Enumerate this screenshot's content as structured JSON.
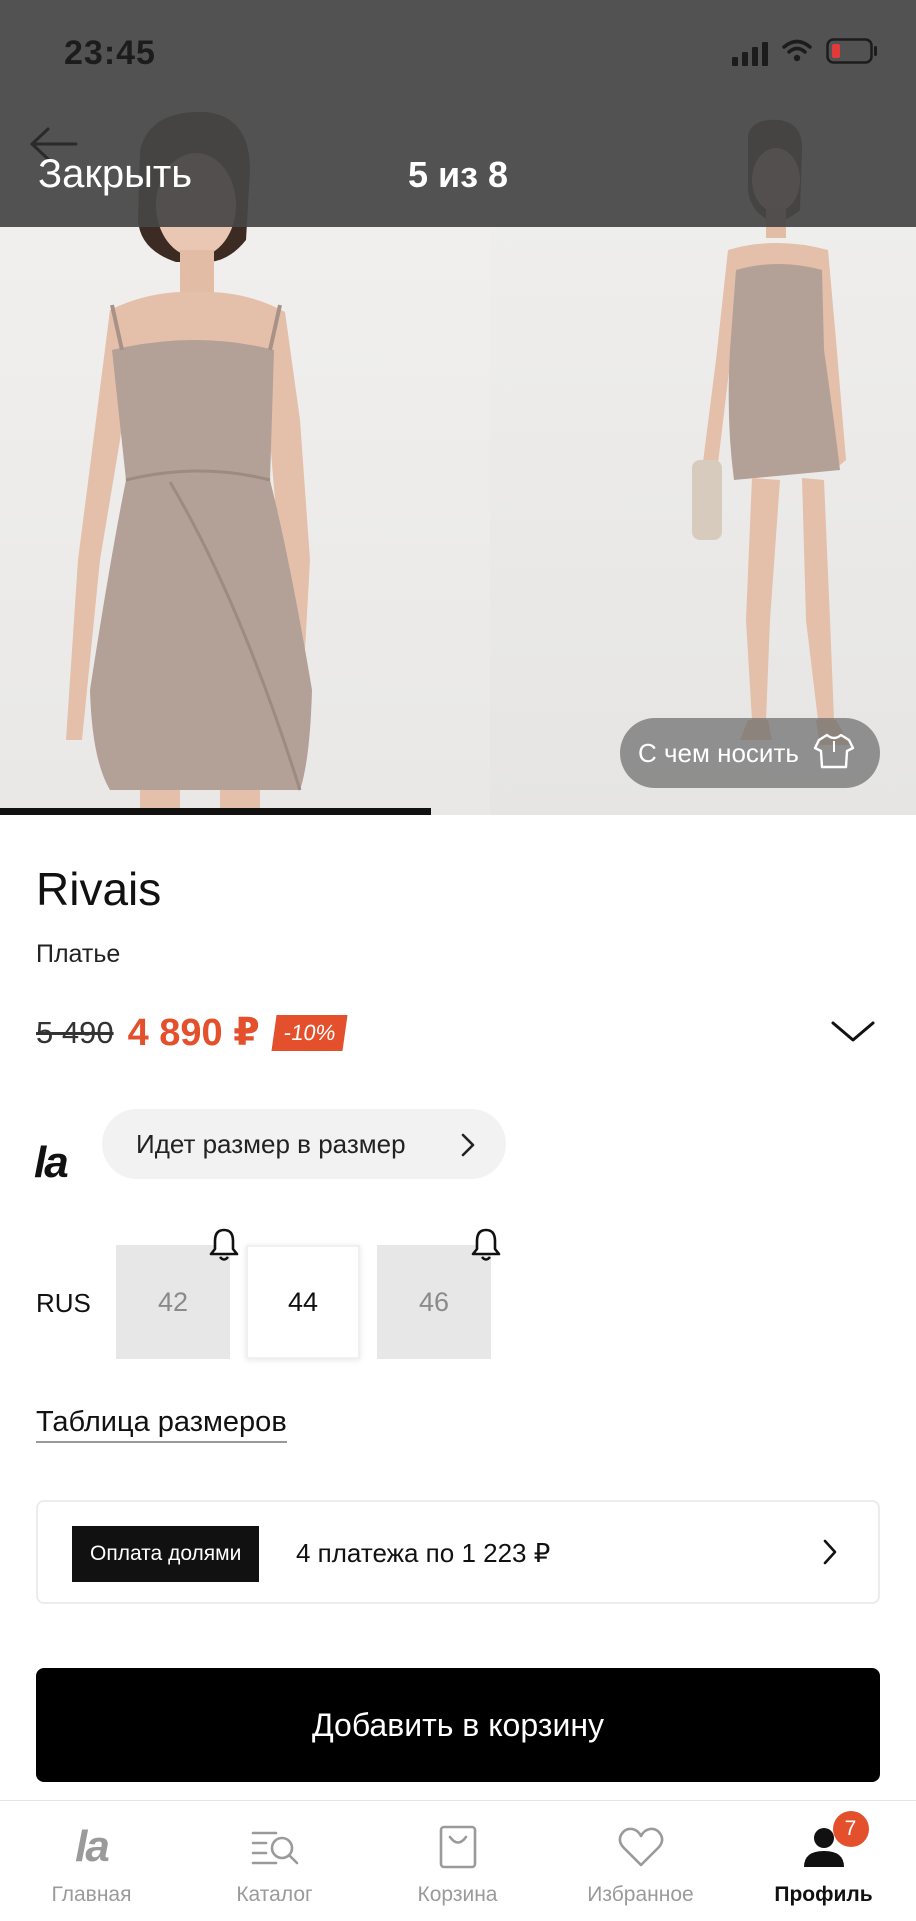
{
  "status_bar": {
    "time": "23:45"
  },
  "header": {
    "close_label": "Закрыть",
    "counter": "5 из 8"
  },
  "gallery": {
    "wear_button_label": "С чем носить",
    "progress": 0.47
  },
  "product": {
    "brand": "Rivais",
    "category": "Платье",
    "old_price": "5 490",
    "new_price": "4 890 ₽",
    "discount": "-10%"
  },
  "fit": {
    "logo": "la",
    "message": "Идет размер в размер"
  },
  "sizes": {
    "system": "RUS",
    "items": [
      {
        "label": "42",
        "available": false
      },
      {
        "label": "44",
        "available": true
      },
      {
        "label": "46",
        "available": false
      }
    ],
    "table_link": "Таблица размеров"
  },
  "installments": {
    "badge": "Оплата долями",
    "text": "4 платежа по 1 223 ₽"
  },
  "cta": {
    "add_to_cart": "Добавить в корзину"
  },
  "tabbar": {
    "items": [
      {
        "label": "Главная",
        "icon": "la-logo-icon"
      },
      {
        "label": "Каталог",
        "icon": "catalog-search-icon"
      },
      {
        "label": "Корзина",
        "icon": "shopping-bag-icon"
      },
      {
        "label": "Избранное",
        "icon": "heart-icon"
      },
      {
        "label": "Профиль",
        "icon": "profile-icon"
      }
    ],
    "logo": "la",
    "active": "Профиль",
    "profile_badge": "7"
  },
  "colors": {
    "accent": "#e5502c",
    "primary": "#000000",
    "muted": "#9a9a9a"
  }
}
